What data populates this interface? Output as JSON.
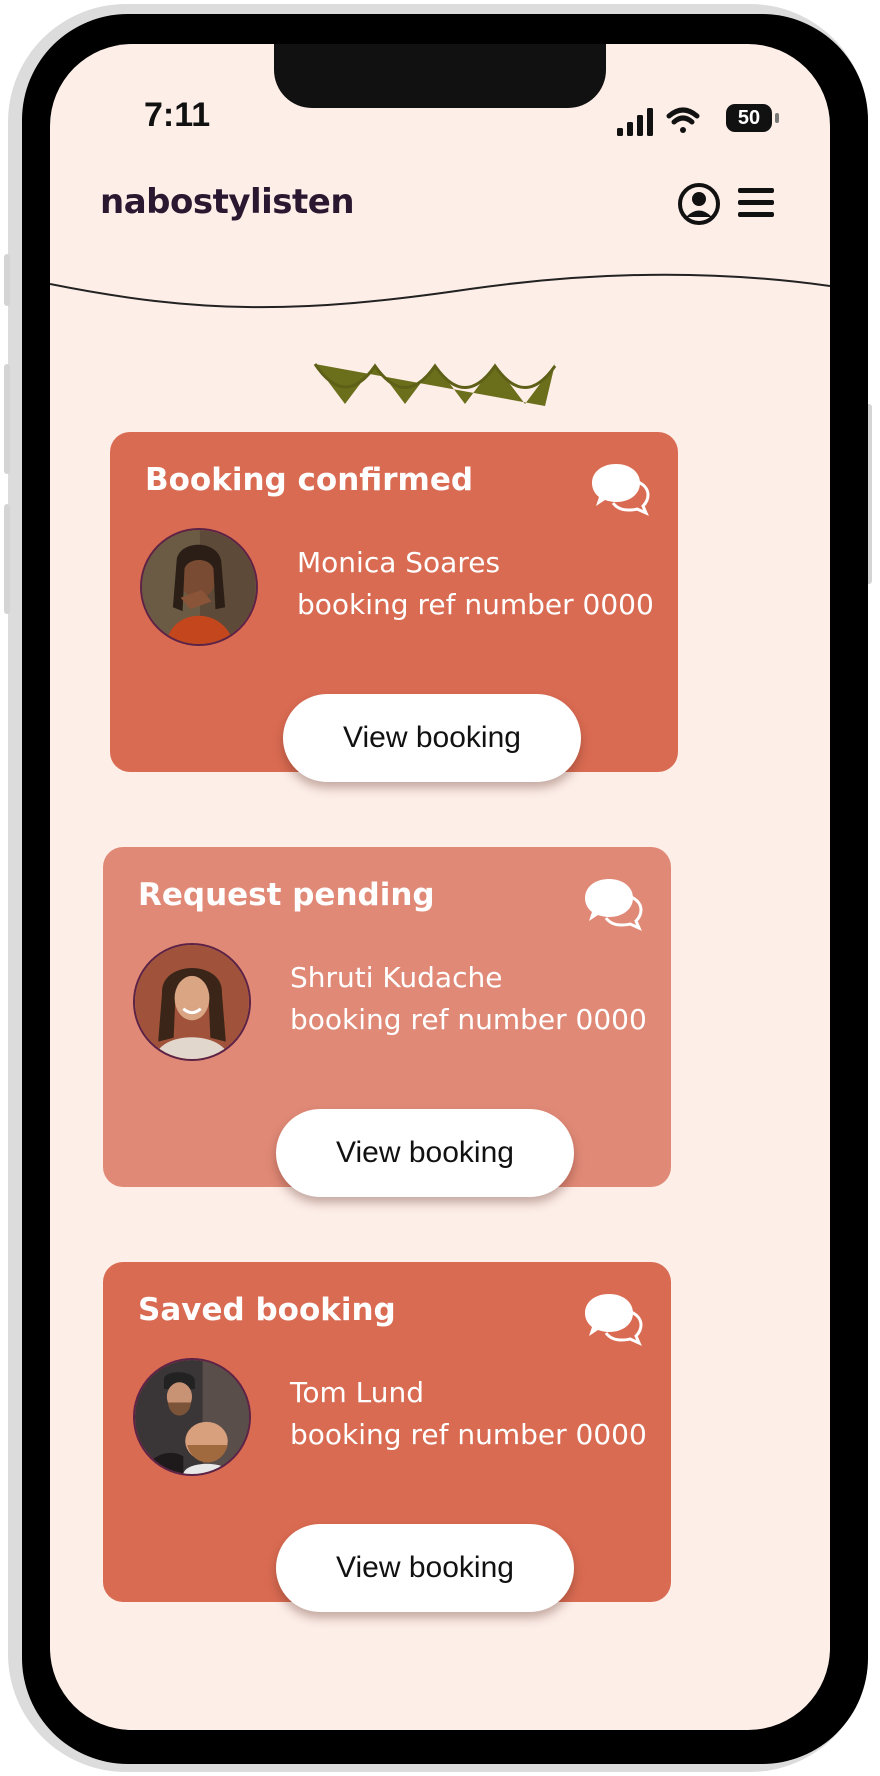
{
  "status_bar": {
    "time": "7:11",
    "battery": "50"
  },
  "header": {
    "brand": "nabostylisten"
  },
  "colors": {
    "background": "#fdeee8",
    "card_primary": "#d96b52",
    "card_secondary": "#e08977",
    "brand_text": "#2a1830",
    "accent_olive": "#6b6e1a"
  },
  "icons": {
    "profile": "user-circle-icon",
    "menu": "hamburger-menu-icon",
    "chat": "chat-bubbles-icon"
  },
  "bookings": [
    {
      "status": "Booking confirmed",
      "name": "Monica Soares",
      "ref": "booking ref number 0000",
      "button": "View booking"
    },
    {
      "status": "Request pending",
      "name": "Shruti Kudache",
      "ref": "booking ref number 0000",
      "button": "View booking"
    },
    {
      "status": "Saved booking",
      "name": "Tom Lund",
      "ref": "booking ref number 0000",
      "button": "View booking"
    }
  ]
}
